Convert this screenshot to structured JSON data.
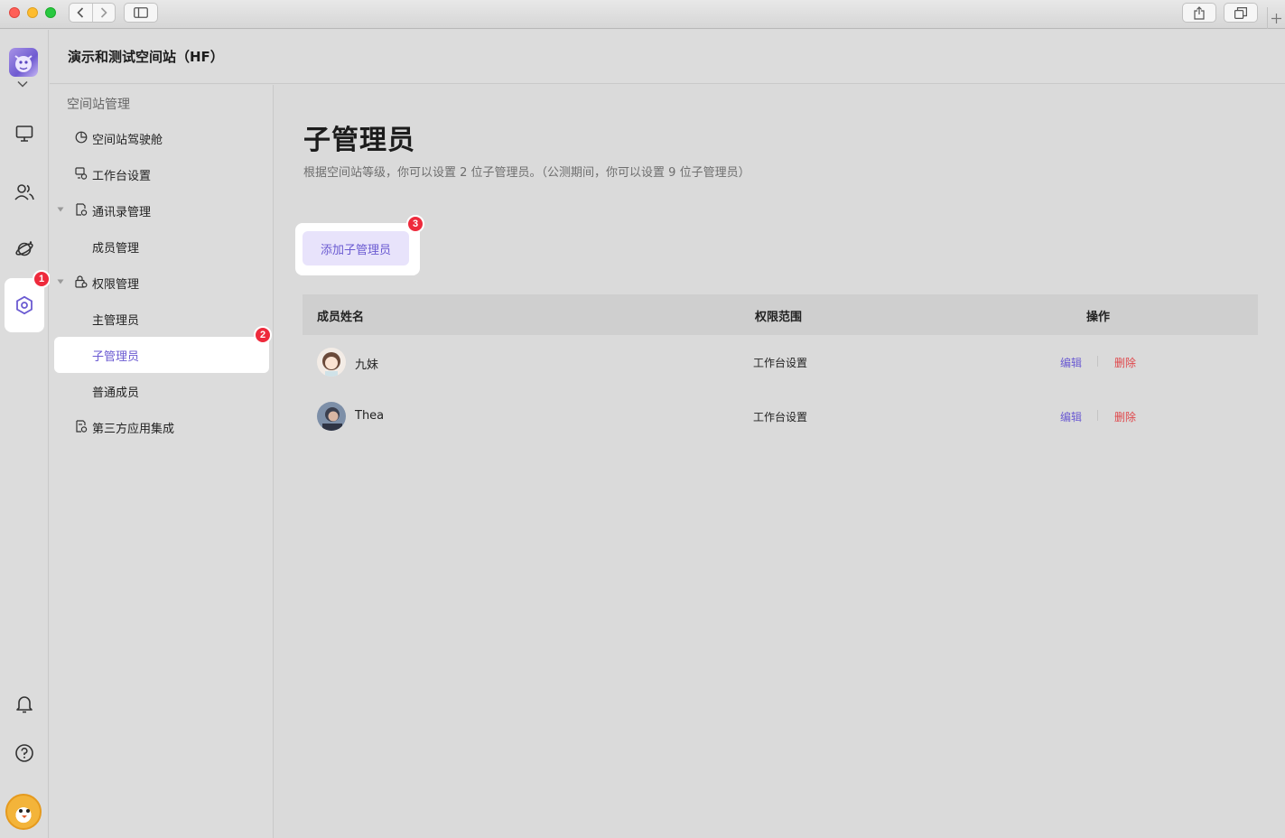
{
  "header": {
    "title": "演示和测试空间站（HF）"
  },
  "subnav": {
    "section": "空间站管理",
    "items": [
      {
        "label": "空间站驾驶舱",
        "icon": "dashboard-icon"
      },
      {
        "label": "工作台设置",
        "icon": "workbench-icon"
      },
      {
        "label": "通讯录管理",
        "icon": "contacts-icon",
        "expanded": true
      },
      {
        "label": "成员管理"
      },
      {
        "label": "权限管理",
        "icon": "permission-icon",
        "expanded": true
      },
      {
        "label": "主管理员"
      },
      {
        "label": "子管理员",
        "selected": true
      },
      {
        "label": "普通成员"
      },
      {
        "label": "第三方应用集成",
        "icon": "integration-icon"
      }
    ]
  },
  "badges": {
    "one": "1",
    "two": "2",
    "three": "3"
  },
  "page": {
    "title": "子管理员",
    "description": "根据空间站等级，你可以设置 2 位子管理员。（公测期间，你可以设置 9 位子管理员）",
    "add_button": "添加子管理员"
  },
  "table": {
    "headers": {
      "name": "成员姓名",
      "scope": "权限范围",
      "actions": "操作"
    },
    "rows": [
      {
        "name": "九妹",
        "scope": "工作台设置",
        "edit": "编辑",
        "delete": "删除"
      },
      {
        "name": "Thea",
        "scope": "工作台设置",
        "edit": "编辑",
        "delete": "删除"
      }
    ]
  },
  "colors": {
    "accent": "#6b5bd2",
    "danger": "#e0474b",
    "badge": "#ee2a3c"
  }
}
